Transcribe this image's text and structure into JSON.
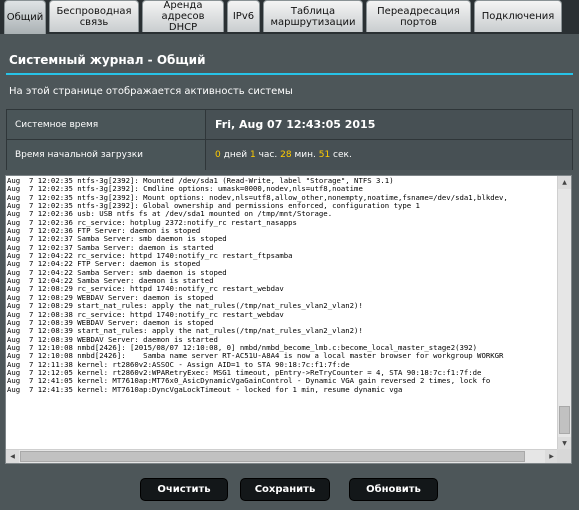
{
  "tabs": [
    {
      "label_lines": [
        "Общий"
      ],
      "active": true
    },
    {
      "label_lines": [
        "Беспроводная",
        "связь"
      ]
    },
    {
      "label_lines": [
        "Аренда",
        "адресов",
        "DHCP"
      ]
    },
    {
      "label_lines": [
        "IPv6"
      ]
    },
    {
      "label_lines": [
        "Таблица",
        "маршрутизации"
      ]
    },
    {
      "label_lines": [
        "Переадресация",
        "портов"
      ]
    },
    {
      "label_lines": [
        "Подключения"
      ]
    }
  ],
  "page": {
    "title": "Системный журнал - Общий",
    "description": "На этой странице отображается активность системы"
  },
  "info": {
    "system_time_label": "Системное время",
    "system_time_value": "Fri, Aug 07 12:43:05 2015",
    "boot_time_label": "Время начальной загрузки",
    "uptime": {
      "days": "0",
      "days_label": "дней",
      "hours": "1",
      "hours_label": "час.",
      "minutes": "28",
      "minutes_label": "мин.",
      "seconds": "51",
      "seconds_label": "сек."
    }
  },
  "log": {
    "lines": [
      "Aug  7 12:02:35 ntfs-3g[2392]: Mounted /dev/sda1 (Read-Write, label \"Storage\", NTFS 3.1)",
      "Aug  7 12:02:35 ntfs-3g[2392]: Cmdline options: umask=0000,nodev,nls=utf8,noatime",
      "Aug  7 12:02:35 ntfs-3g[2392]: Mount options: nodev,nls=utf8,allow_other,nonempty,noatime,fsname=/dev/sda1,blkdev,",
      "Aug  7 12:02:35 ntfs-3g[2392]: Global ownership and permissions enforced, configuration type 1",
      "Aug  7 12:02:36 usb: USB ntfs fs at /dev/sda1 mounted on /tmp/mnt/Storage.",
      "Aug  7 12:02:36 rc_service: hotplug 2372:notify_rc restart_nasapps",
      "Aug  7 12:02:36 FTP Server: daemon is stoped",
      "Aug  7 12:02:37 Samba Server: smb daemon is stoped",
      "Aug  7 12:02:37 Samba Server: daemon is started",
      "Aug  7 12:04:22 rc_service: httpd 1740:notify_rc restart_ftpsamba",
      "Aug  7 12:04:22 FTP Server: daemon is stoped",
      "Aug  7 12:04:22 Samba Server: smb daemon is stoped",
      "Aug  7 12:04:22 Samba Server: daemon is started",
      "Aug  7 12:08:29 rc_service: httpd 1740:notify_rc restart_webdav",
      "Aug  7 12:08:29 WEBDAV Server: daemon is stoped",
      "Aug  7 12:08:29 start_nat_rules: apply the nat_rules(/tmp/nat_rules_vlan2_vlan2)!",
      "Aug  7 12:08:38 rc_service: httpd 1740:notify_rc restart_webdav",
      "Aug  7 12:08:39 WEBDAV Server: daemon is stoped",
      "Aug  7 12:08:39 start_nat_rules: apply the nat_rules(/tmp/nat_rules_vlan2_vlan2)!",
      "Aug  7 12:08:39 WEBDAV Server: daemon is started",
      "Aug  7 12:10:08 nmbd[2426]: [2015/08/07 12:10:08, 0] nmbd/nmbd_become_lmb.c:become_local_master_stage2(392)",
      "Aug  7 12:10:08 nmbd[2426]:    Samba name server RT-AC51U-A8A4 is now a local master browser for workgroup WORKGR",
      "Aug  7 12:11:38 kernel: rt2860v2:ASSOC - Assign AID=1 to STA 90:18:7c:f1:7f:de",
      "Aug  7 12:12:05 kernel: rt2860v2:WPARetryExec: MSG1 timeout, pEntry->ReTryCounter = 4, STA 90:18:7c:f1:7f:de",
      "Aug  7 12:41:05 kernel: MT7610ap:MT76x0_AsicDynamicVgaGainControl - Dynamic VGA gain reversed 2 times, lock fo",
      "Aug  7 12:41:35 kernel: MT7610ap:DyncVgaLockTimeout - locked for 1 min, resume dynamic vga"
    ]
  },
  "buttons": {
    "clear": "Очистить",
    "save": "Сохранить",
    "refresh": "Обновить"
  },
  "colors": {
    "accent_line": "#27c3e8",
    "uptime_number": "#ffcc00",
    "background": "#4d5659"
  }
}
